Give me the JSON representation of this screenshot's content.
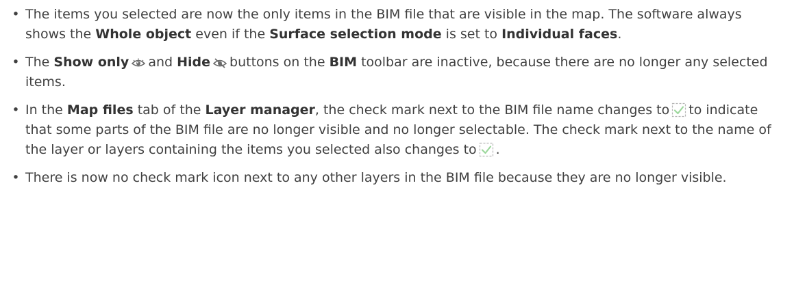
{
  "bullets": [
    {
      "segments": [
        {
          "t": "The items you selected are now the only items in the BIM file that are visible in the map. The software always shows the "
        },
        {
          "t": "Whole object",
          "b": true
        },
        {
          "t": " even if the "
        },
        {
          "t": "Surface selection mode",
          "b": true
        },
        {
          "t": " is set to "
        },
        {
          "t": "Individual faces",
          "b": true
        },
        {
          "t": "."
        }
      ]
    },
    {
      "segments": [
        {
          "t": "The "
        },
        {
          "t": "Show only",
          "b": true
        },
        {
          "icon": "show-only-eye-icon"
        },
        {
          "t": "and "
        },
        {
          "t": "Hide",
          "b": true
        },
        {
          "icon": "hide-eye-icon"
        },
        {
          "t": "buttons on the "
        },
        {
          "t": "BIM",
          "b": true
        },
        {
          "t": " toolbar are inactive, because there are no longer any selected items."
        }
      ]
    },
    {
      "segments": [
        {
          "t": "In the "
        },
        {
          "t": "Map files",
          "b": true
        },
        {
          "t": " tab of the "
        },
        {
          "t": "Layer manager",
          "b": true
        },
        {
          "t": ", the check mark next to the BIM file name changes to"
        },
        {
          "icon": "partial-check-icon"
        },
        {
          "t": "to indicate that some parts of the BIM file are no longer visible and no longer selectable. The check mark next to the name of the layer or layers containing the items you selected also changes to"
        },
        {
          "icon": "partial-check-icon"
        },
        {
          "t": "."
        }
      ]
    },
    {
      "segments": [
        {
          "t": "There is now no check mark icon next to any other layers in the BIM file because they are no longer visible."
        }
      ]
    }
  ],
  "colors": {
    "text": "#404040",
    "icon": "#6b6b6b",
    "check": "#9cd79c",
    "check_border": "#b5b5b5"
  }
}
